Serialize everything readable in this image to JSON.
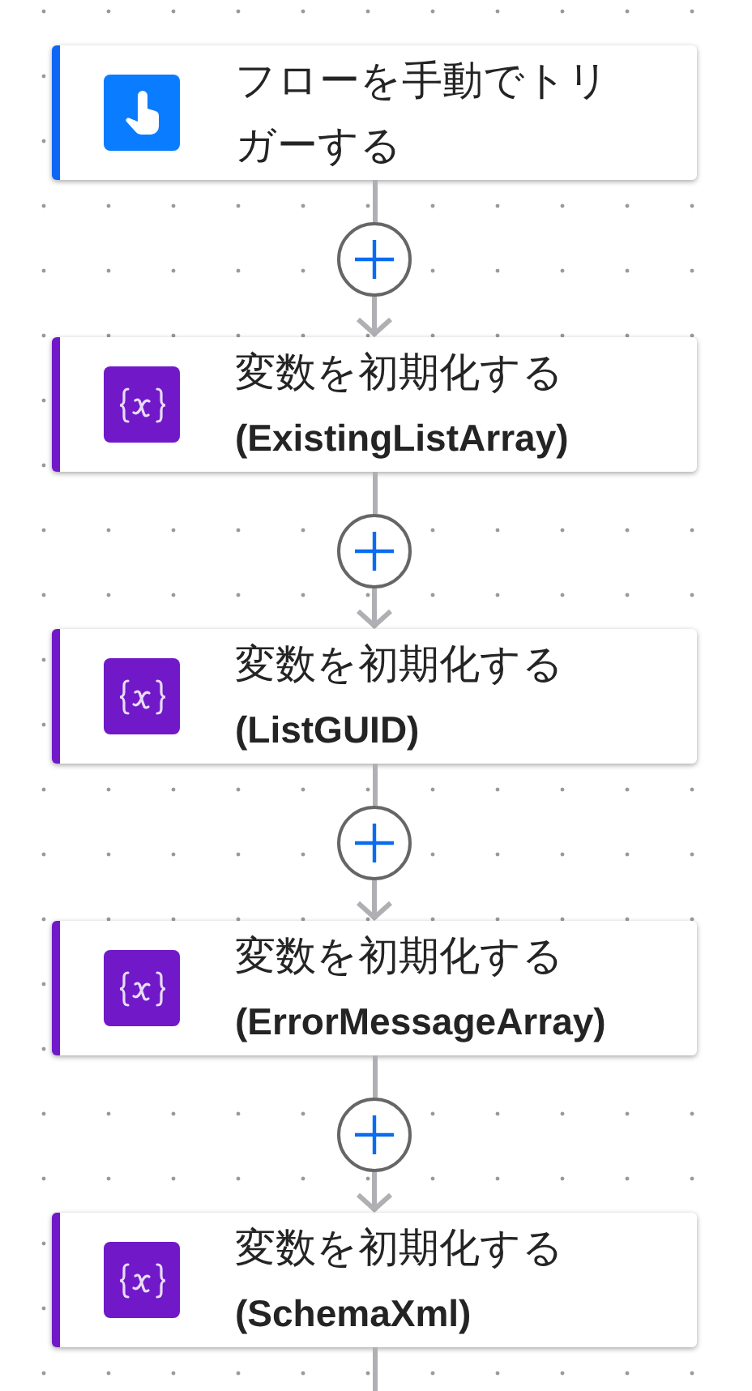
{
  "steps": [
    {
      "kind": "trigger",
      "title": "フローを手動でトリガーする"
    },
    {
      "kind": "variable",
      "title": "変数を初期化する",
      "subtitle": "(ExistingListArray)"
    },
    {
      "kind": "variable",
      "title": "変数を初期化する",
      "subtitle": "(ListGUID)"
    },
    {
      "kind": "variable",
      "title": "変数を初期化する",
      "subtitle": "(ErrorMessageArray)"
    },
    {
      "kind": "variable",
      "title": "変数を初期化する",
      "subtitle": "(SchemaXml)"
    }
  ]
}
